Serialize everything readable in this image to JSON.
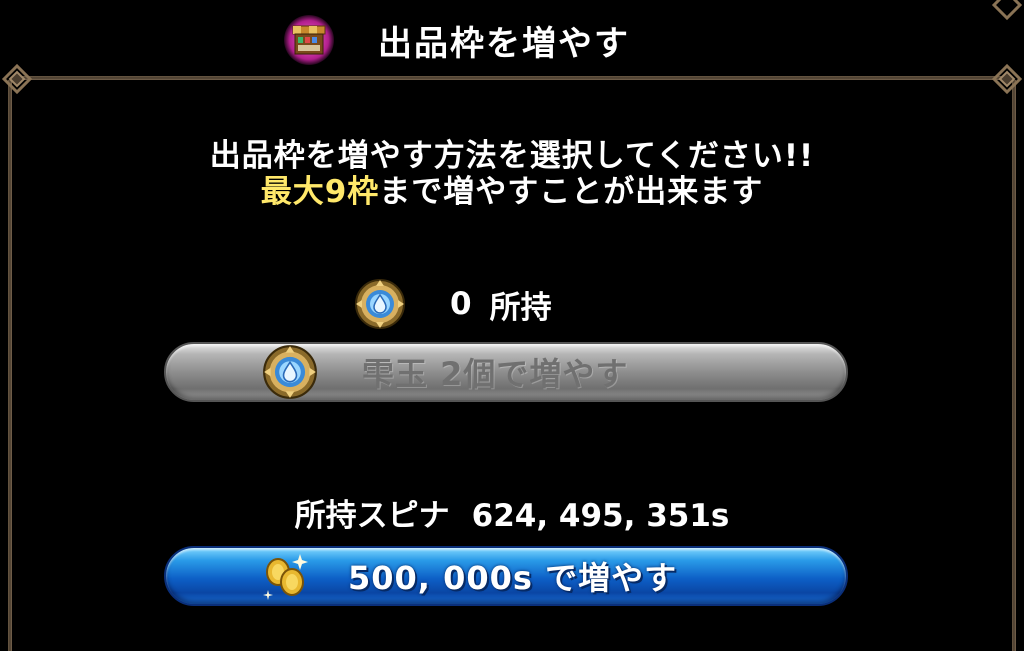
{
  "header": {
    "title": "出品枠を増やす",
    "icon": "market-stall-icon"
  },
  "message": {
    "line1": "出品枠を増やす方法を選択してください!!",
    "line2_highlight": "最大9枠",
    "line2_rest": "まで増やすことが出来ます"
  },
  "item": {
    "icon": "droplet-orb-icon",
    "owned_count": "0",
    "owned_label": "所持"
  },
  "item_button": {
    "icon": "droplet-orb-icon",
    "label": "雫玉 2個で増やす",
    "enabled": false
  },
  "spina": {
    "label": "所持スピナ",
    "amount": "624, 495, 351s"
  },
  "spina_button": {
    "icon": "gold-coins-icon",
    "label": "500, 000s で増やす"
  },
  "colors": {
    "highlight": "#ffe86a",
    "button_blue": "#0d5fc6",
    "button_gray": "#8e8e8e",
    "frame": "#6b5a45"
  }
}
